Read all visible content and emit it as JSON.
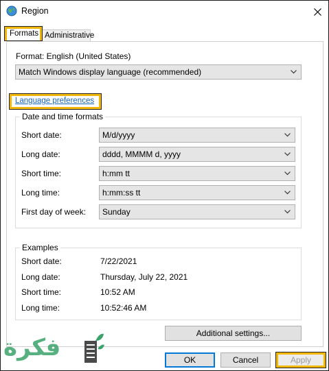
{
  "window": {
    "title": "Region"
  },
  "tabs": [
    {
      "label": "Formats",
      "active": true
    },
    {
      "label": "Administrative",
      "active": false
    }
  ],
  "format": {
    "label": "Format: English (United States)",
    "selected": "Match Windows display language (recommended)"
  },
  "language_preferences_link": "Language preferences",
  "date_time_formats": {
    "title": "Date and time formats",
    "rows": [
      {
        "label": "Short date:",
        "value": "M/d/yyyy"
      },
      {
        "label": "Long date:",
        "value": "dddd, MMMM d, yyyy"
      },
      {
        "label": "Short time:",
        "value": "h:mm tt"
      },
      {
        "label": "Long time:",
        "value": "h:mm:ss tt"
      },
      {
        "label": "First day of week:",
        "value": "Sunday"
      }
    ]
  },
  "examples": {
    "title": "Examples",
    "rows": [
      {
        "label": "Short date:",
        "value": "7/22/2021"
      },
      {
        "label": "Long date:",
        "value": "Thursday, July 22, 2021"
      },
      {
        "label": "Short time:",
        "value": "10:52 AM"
      },
      {
        "label": "Long time:",
        "value": "10:52:46 AM"
      }
    ]
  },
  "buttons": {
    "additional": "Additional settings...",
    "ok": "OK",
    "cancel": "Cancel",
    "apply": "Apply"
  },
  "watermark": {
    "text": "فكرة"
  },
  "colors": {
    "highlight": "#f2b705",
    "link": "#1466b8",
    "focus": "#0078d7"
  }
}
